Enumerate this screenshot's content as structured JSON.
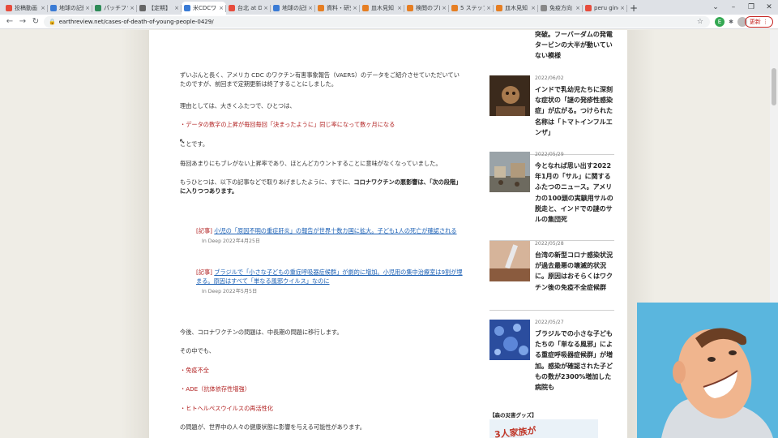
{
  "browser": {
    "tabs": [
      {
        "label": "投稿動画",
        "color": "#e74c3c",
        "active": false
      },
      {
        "label": "地球の記録",
        "color": "#3a7bd5",
        "active": false
      },
      {
        "label": "パッチフラワー",
        "color": "#2e8b57",
        "active": false
      },
      {
        "label": "【定期】",
        "color": "#666666",
        "active": false
      },
      {
        "label": "米CDCワク",
        "color": "#3a7bd5",
        "active": true
      },
      {
        "label": "台北 at D",
        "color": "#e74c3c",
        "active": false
      },
      {
        "label": "地球の記録",
        "color": "#3a7bd5",
        "active": false
      },
      {
        "label": "資料・研究",
        "color": "#e67e22",
        "active": false
      },
      {
        "label": "皿木見知",
        "color": "#e67e22",
        "active": false
      },
      {
        "label": "検閲のブロ",
        "color": "#e67e22",
        "active": false
      },
      {
        "label": "5 ステップ",
        "color": "#e67e22",
        "active": false
      },
      {
        "label": "皿木見知",
        "color": "#e67e22",
        "active": false
      },
      {
        "label": "免疫方向",
        "color": "#888888",
        "active": false
      },
      {
        "label": "peru ginc",
        "color": "#e74c3c",
        "active": false
      }
    ],
    "new_tab": "+",
    "window_controls": {
      "minimize": "–",
      "maximize": "❐",
      "close": "✕"
    },
    "url": "earthreview.net/cases-of-death-of-young-people-0429/",
    "update_label": "更新 ⋮"
  },
  "article": {
    "p1": "ずいぶんと長く、アメリカ CDC のワクチン有害事象報告（VAERS）のデータをご紹介させていただいていたのですが、前回まで定期更新は終了することにしました。",
    "p2": "理由としては、大きくふたつで、ひとつは、",
    "p3": "・データの数字の上昇が毎回毎回「決まったように」同じ率になって数ヶ月になる",
    "p4": "ことです。",
    "p5": "毎回あまりにもブレがない上昇率であり、ほとんどカウントすることに意味がなくなっていました。",
    "p6a": "もうひとつは、以下の記事などで取りあげましたように、すでに、",
    "p6b": "コロナワクチンの悪影響は、「次の段階」に入りつつあります。",
    "quote1": {
      "tag": "[記事]",
      "link": "小児の「原因不明の重症肝炎」の報告が世界十数カ国に拡大。子ども1人の死亡が確認される",
      "meta": "In Deep 2022年4月25日"
    },
    "quote2": {
      "tag": "[記事]",
      "link": "ブラジルで「小さな子どもの重症呼吸器症候群」が劇的に増加。小児用の集中治療室は9割が埋まる。原因はすべて「単なる風邪ウイルス」なのに",
      "meta": "In Deep 2022年5月5日"
    },
    "p7": "今後、コロナワクチンの問題は、中長期の問題に移行します。",
    "p8": "その中でも、",
    "bullet1": "・免疫不全",
    "bullet2": "・ADE（抗体依存性増強）",
    "bullet3": "・ヒトヘルペスウイルスの再活性化",
    "p9": "の問題が、世界中の人々の健康状態に影響を与える可能性があります。"
  },
  "sidebar": {
    "top_title": "突破。フーバーダムの発電タービンの大半が動いていない模様",
    "posts": [
      {
        "date": "2022/06/02",
        "title": "インドで乳幼児たちに深刻な症状の「謎の発疹性感染症」が広がる。つけられた名称は「トマトインフルエンザ」"
      },
      {
        "date": "2022/05/29",
        "title": "今となれば思い出す2022年1月の「サル」に関するふたつのニュース。アメリカの100頭の実験用サルの脱走と、インドでの謎のサルの集団死"
      },
      {
        "date": "2022/05/28",
        "title": "台湾の新型コロナ感染状況が過去最悪の壊滅的状況に。原因はおそらくはワクチン後の免疫不全症候群"
      },
      {
        "date": "2022/05/27",
        "title": "ブラジルでの小さな子どもたちの「単なる風邪」による重症呼吸器症候群」が増加。感染が確認された子どもの数が2300%増加した病院も"
      }
    ],
    "goods_label": "【森の災害グッズ】",
    "banner_text": "3人家族が"
  }
}
